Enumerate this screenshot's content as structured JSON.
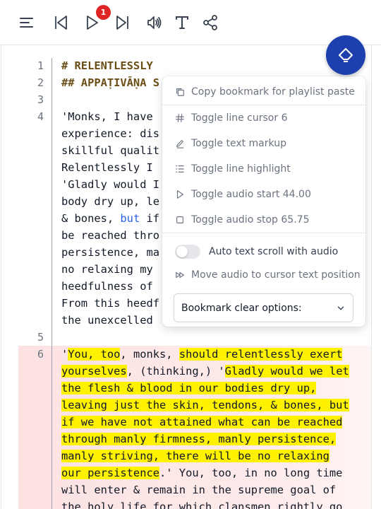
{
  "toolbar": {
    "badge_count": "1",
    "icons": [
      "menu-icon",
      "skip-previous-icon",
      "play-icon",
      "skip-next-icon",
      "speaker-icon",
      "text-format-icon",
      "share-icon"
    ]
  },
  "editor": {
    "lines": [
      {
        "num": "1",
        "text": "# RELENTLESSLY"
      },
      {
        "num": "2",
        "text": "## APPAṬIVĀṆA S"
      },
      {
        "num": "3",
        "text": ""
      },
      {
        "num": "4",
        "wrapped": [
          "'Monks, I have",
          "experience: dis",
          "skillful qualit",
          "Relentlessly I",
          "'Gladly would I",
          "body dry up, le",
          "& bones, ",
          "be reached thro",
          "persistence, ma",
          "no relaxing my",
          "heedfulness of",
          "From this heedf",
          "the unexcelled"
        ],
        "keyword_but": "but",
        "after_but": " if"
      },
      {
        "num": "5",
        "text": ""
      },
      {
        "num": "6",
        "segments": {
          "l1a": "'",
          "l1b": "You, too",
          "l1c": ", monks, ",
          "l1d": "should relentlessly exert",
          "l2a": "yourselves",
          "l2b": ", (thinking,) '",
          "l2c": "Gladly would we let",
          "l3": "the flesh & blood in our bodies dry up,",
          "l4": "leaving just the skin, tendons, & bones, but",
          "l5": "if we have not attained what can be reached",
          "l6": "through manly firmness, manly persistence,",
          "l7": "manly striving, there will be no relaxing",
          "l8a": "our persistence",
          "l8b": ".' You, too, in no long time",
          "l9": "will enter & remain in the supreme goal of",
          "l10": "the holy life for which clansmen rightly go"
        }
      }
    ]
  },
  "menu": {
    "copy_bookmark": "Copy bookmark for playlist paste",
    "toggle_cursor": "Toggle line cursor 6",
    "toggle_markup": "Toggle text markup",
    "toggle_highlight": "Toggle line highlight",
    "toggle_audio_start": "Toggle audio start 44.00",
    "toggle_audio_stop": "Toggle audio stop 65.75",
    "auto_scroll": "Auto text scroll with audio",
    "move_audio": "Move audio to cursor text position",
    "clear_options": "Bookmark clear options:"
  },
  "colors": {
    "fab": "#1e40af",
    "highlight": "#fff200",
    "badge": "#e02424",
    "line_bg": "#fde2e2"
  }
}
